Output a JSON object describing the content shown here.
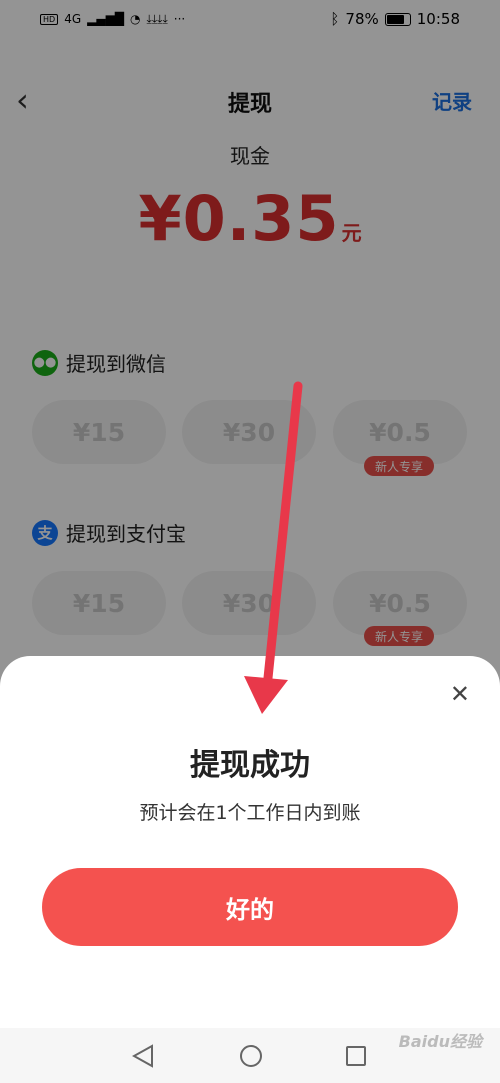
{
  "status_bar": {
    "left_badge": "HD",
    "network": "4G",
    "battery": "78%",
    "time": "10:58"
  },
  "header": {
    "back_icon": "chevron-left",
    "title": "提现",
    "record": "记录"
  },
  "balance": {
    "label": "现金",
    "amount": "¥0.35",
    "unit": "元"
  },
  "wechat": {
    "icon": "wechat-icon",
    "title": "提现到微信",
    "options": [
      {
        "label": "¥15",
        "tag": ""
      },
      {
        "label": "¥30",
        "tag": ""
      },
      {
        "label": "¥0.5",
        "tag": "新人专享"
      }
    ]
  },
  "alipay": {
    "icon_char": "支",
    "title": "提现到支付宝",
    "options": [
      {
        "label": "¥15",
        "tag": ""
      },
      {
        "label": "¥30",
        "tag": ""
      },
      {
        "label": "¥0.5",
        "tag": "新人专享"
      }
    ]
  },
  "dialog": {
    "title": "提现成功",
    "subtitle": "预计会在1个工作日内到账",
    "ok_button": "好的",
    "close_icon": "close-icon"
  },
  "watermark": "Baidu经验",
  "colors": {
    "accent_red": "#f4524f",
    "amount_red": "#d9302f",
    "link_blue": "#1a6fe0",
    "wechat_green": "#1aad19",
    "alipay_blue": "#1677ff",
    "arrow_red": "#e8384a"
  }
}
